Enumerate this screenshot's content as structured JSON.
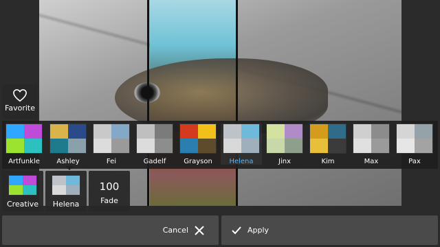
{
  "favorite": {
    "label": "Favorite",
    "icon": "heart-icon"
  },
  "filters": [
    {
      "name": "Artfunkle",
      "colors": [
        "#2fa7ff",
        "#c04bd8",
        "#9be32f",
        "#2dc0c0"
      ]
    },
    {
      "name": "Ashley",
      "colors": [
        "#d9b44a",
        "#2b4a8a",
        "#1e7b8e",
        "#8aa0aa"
      ]
    },
    {
      "name": "Fei",
      "colors": [
        "#c9c9c9",
        "#84a8c8",
        "#dcdcdc",
        "#9a9a9a"
      ]
    },
    {
      "name": "Gadelf",
      "colors": [
        "#bfbfbf",
        "#7b7b7b",
        "#dcdcdc",
        "#8d8d8d"
      ]
    },
    {
      "name": "Grayson",
      "colors": [
        "#d43a1e",
        "#f1c11a",
        "#2a7fb0",
        "#5e4b2b"
      ]
    },
    {
      "name": "Helena",
      "colors": [
        "#bdc3c8",
        "#6fb9da",
        "#d9d9d9",
        "#9fb0bc"
      ],
      "selected": true
    },
    {
      "name": "Jinx",
      "colors": [
        "#d3e39f",
        "#b08bc7",
        "#c9d8a8",
        "#8ea08b"
      ]
    },
    {
      "name": "Kim",
      "colors": [
        "#d49c1d",
        "#2e6c8a",
        "#e7bf3a",
        "#3b3b3b"
      ]
    },
    {
      "name": "Max",
      "colors": [
        "#cfcfcf",
        "#8c8c8c",
        "#e0e0e0",
        "#9a9a9a"
      ]
    },
    {
      "name": "Pax",
      "colors": [
        "#d5d5d5",
        "#96a2aa",
        "#e6e6e6",
        "#a3a3a3"
      ]
    }
  ],
  "tools": {
    "creative": {
      "label": "Creative",
      "colors": [
        "#2fa7ff",
        "#c04bd8",
        "#9be32f",
        "#2dc0c0"
      ]
    },
    "helena": {
      "label": "Helena"
    },
    "fade": {
      "value": "100",
      "label": "Fade"
    }
  },
  "actions": {
    "cancel": "Cancel",
    "apply": "Apply"
  },
  "colors": {
    "selected_text": "#4fb7ff",
    "panel": "#1e1e1e",
    "button": "#4a4a4a"
  }
}
